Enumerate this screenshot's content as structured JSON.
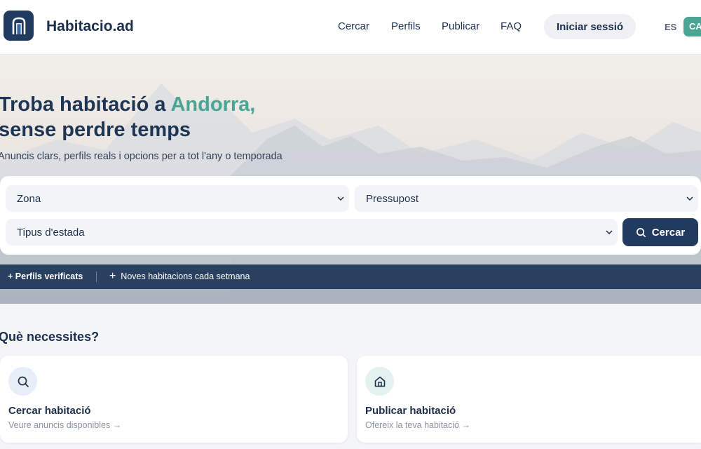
{
  "header": {
    "brand": "Habitacio.ad",
    "nav": [
      "Cercar",
      "Perfils",
      "Publicar",
      "FAQ"
    ],
    "login": "Iniciar sessió",
    "languages": {
      "es": "ES",
      "ca": "CA",
      "active": "CA"
    }
  },
  "hero": {
    "title_part1": "Troba habitació a ",
    "title_accent": "Andorra,",
    "title_line2": "sense perdre temps",
    "subtitle": "Anuncis clars, perfils reals i opcions per a tot l'any o temporada",
    "search": {
      "zona": "Zona",
      "pressupost": "Pressupost",
      "tipus": "Tipus d'estada",
      "button": "Cercar"
    },
    "trust": {
      "item1": "Perfils verificats",
      "item2": "Noves habitacions cada setmana"
    }
  },
  "needs": {
    "title": "Què necessites?",
    "cards": [
      {
        "title": "Cercar habitació",
        "subtitle": "Veure anuncis disponibles →",
        "icon": "search-icon"
      },
      {
        "title": "Publicar habitació",
        "subtitle": "Ofereix la teva habitació →",
        "icon": "home-icon"
      }
    ]
  },
  "colors": {
    "navy": "#213b5e",
    "accent": "#4aa595"
  }
}
